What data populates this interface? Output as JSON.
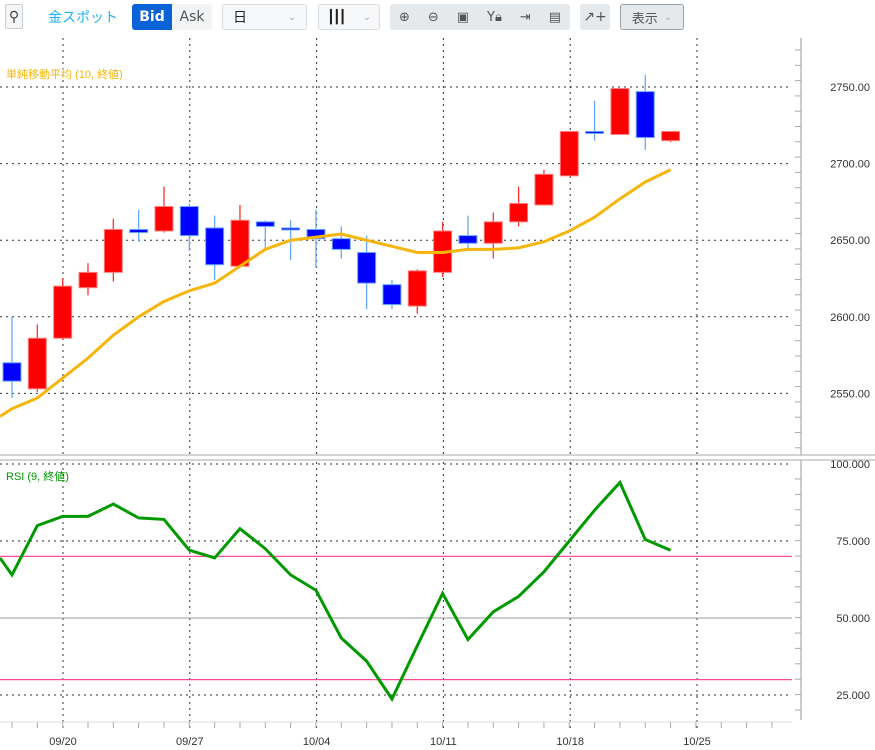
{
  "toolbar": {
    "instrument": "金スポット",
    "bid_label": "Bid",
    "ask_label": "Ask",
    "period_value": "日",
    "view_label": "表示",
    "icons": [
      "search-icon",
      "candlestick-icon",
      "zoom-in-icon",
      "zoom-out-icon",
      "fit-icon",
      "y-axis-lock-icon",
      "scroll-to-end-icon",
      "document-icon",
      "add-indicator-icon"
    ]
  },
  "colors": {
    "up": "#ff0000",
    "down": "#0000ff",
    "ma": "#f5b50a",
    "rsi": "#009900",
    "rsi_band": "#ff4b9a",
    "accent": "#0a63d6"
  },
  "chart_data": [
    {
      "type": "candlestick",
      "indicator_label": "単純移動平均 (10, 終値)",
      "ylim": [
        2520,
        2775
      ],
      "y_ticks": [
        "2750.00",
        "2700.00",
        "2650.00",
        "2600.00",
        "2550.00"
      ],
      "y_tick_values": [
        2750,
        2700,
        2650,
        2600,
        2550
      ],
      "x_tick_labels": [
        "09/20",
        "09/27",
        "10/04",
        "10/11",
        "10/18",
        "10/25"
      ],
      "x_tick_index": [
        2,
        7,
        12,
        17,
        22,
        27
      ],
      "ohlc": [
        [
          2570,
          2600,
          2547,
          2558
        ],
        [
          2553,
          2595,
          2551,
          2586
        ],
        [
          2586,
          2625,
          2585,
          2620
        ],
        [
          2619,
          2635,
          2614,
          2629
        ],
        [
          2629,
          2664,
          2623,
          2657
        ],
        [
          2657,
          2670,
          2649,
          2655
        ],
        [
          2656,
          2685,
          2655,
          2672
        ],
        [
          2672,
          2674,
          2643,
          2653
        ],
        [
          2658,
          2666,
          2624,
          2634
        ],
        [
          2633,
          2673,
          2633,
          2663
        ],
        [
          2662,
          2663,
          2644,
          2659
        ],
        [
          2658,
          2663,
          2637,
          2657
        ],
        [
          2657,
          2670,
          2632,
          2651
        ],
        [
          2651,
          2659,
          2638,
          2644
        ],
        [
          2642,
          2653,
          2605,
          2622
        ],
        [
          2621,
          2624,
          2605,
          2608
        ],
        [
          2607,
          2631,
          2602,
          2630
        ],
        [
          2629,
          2662,
          2626,
          2656
        ],
        [
          2653,
          2666,
          2644,
          2648
        ],
        [
          2648,
          2668,
          2638,
          2662
        ],
        [
          2662,
          2685,
          2659,
          2674
        ],
        [
          2673,
          2696,
          2673,
          2693
        ],
        [
          2692,
          2721,
          2692,
          2721
        ],
        [
          2721,
          2741,
          2715,
          2720
        ],
        [
          2719,
          2749,
          2719,
          2749
        ],
        [
          2747,
          2758,
          2709,
          2717
        ],
        [
          2715,
          2721,
          2714,
          2721
        ]
      ],
      "ma": [
        2540,
        2547,
        2560,
        2573,
        2588,
        2600,
        2610,
        2617,
        2622,
        2633,
        2644,
        2650,
        2652,
        2654,
        2650,
        2646,
        2642,
        2642,
        2644,
        2644,
        2645,
        2649,
        2656,
        2665,
        2677,
        2688,
        2696
      ]
    },
    {
      "type": "line",
      "indicator_label": "RSI (9, 終値)",
      "ylim": [
        15,
        100
      ],
      "y_ticks": [
        "100.000",
        "75.000",
        "50.000",
        "25.000"
      ],
      "y_tick_values": [
        100,
        75,
        50,
        25
      ],
      "bands": [
        70,
        30
      ],
      "midline": 50,
      "values_start": 69.5,
      "values": [
        64,
        80,
        83,
        83,
        87,
        82.5,
        82,
        72,
        69.5,
        79,
        72.5,
        64,
        59,
        43.5,
        36,
        23.7,
        41,
        58,
        43,
        52,
        57,
        65,
        75,
        85,
        94,
        75.5,
        72
      ]
    }
  ]
}
